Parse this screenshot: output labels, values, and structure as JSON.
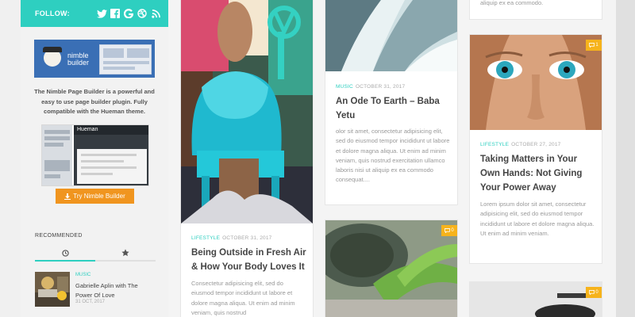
{
  "sidebar": {
    "follow_label": "FOLLOW:",
    "social_icons": [
      "twitter-icon",
      "facebook-icon",
      "google-icon",
      "dribbble-icon",
      "rss-icon"
    ],
    "promo": {
      "brand_line1": "nimble",
      "brand_line2": "builder",
      "description": "The Nimble Page Builder is a powerful and easy to use page builder plugin. Fully compatible with the Hueman theme.",
      "screenshot_brand": "Hueman",
      "button_label": "Try Nimble Builder"
    },
    "recommended": {
      "title": "RECOMMENDED",
      "tabs": [
        {
          "icon": "clock-icon",
          "active": true
        },
        {
          "icon": "star-icon",
          "active": false
        }
      ],
      "item": {
        "category": "MUSIC",
        "title": "Gabrielle Aplin with The Power Of Love",
        "date": "31 OCT, 2017"
      }
    }
  },
  "posts": [
    {
      "category": "LIFESTYLE",
      "date": "OCTOBER 31, 2017",
      "title": "Being Outside in Fresh Air & How Your Body Loves It",
      "excerpt": "Consectetur adipisicing elit, sed do eiusmod tempor incididunt ut labore et dolore magna aliqua. Ut enim ad minim veniam, quis nostrud"
    },
    {
      "category": "MUSIC",
      "date": "OCTOBER 31, 2017",
      "title": "An Ode To Earth – Baba Yetu",
      "excerpt": "olor sit amet, consectetur adipisicing elit, sed do eiusmod tempor incididunt ut labore et dolore magna aliqua. Ut enim ad minim veniam, quis nostrud exercitation ullamco laboris nisi ut aliquip ex ea commodo consequat....",
      "comments": ""
    },
    {
      "top_excerpt": "aliquip ex ea commodo.",
      "category": "LIFESTYLE",
      "date": "OCTOBER 27, 2017",
      "title": "Taking Matters in Your Own Hands: Not Giving Your Power Away",
      "excerpt": "Lorem ipsum dolor sit amet, consectetur adipisicing elit, sed do eiusmod tempor incididunt ut labore et dolore magna aliqua. Ut enim ad minim veniam.",
      "comments": "1"
    },
    {
      "comments": "0"
    },
    {
      "comments": "0"
    }
  ],
  "colors": {
    "accent": "#2ecfc0",
    "button": "#f0951f",
    "badge": "#f6b31b"
  }
}
